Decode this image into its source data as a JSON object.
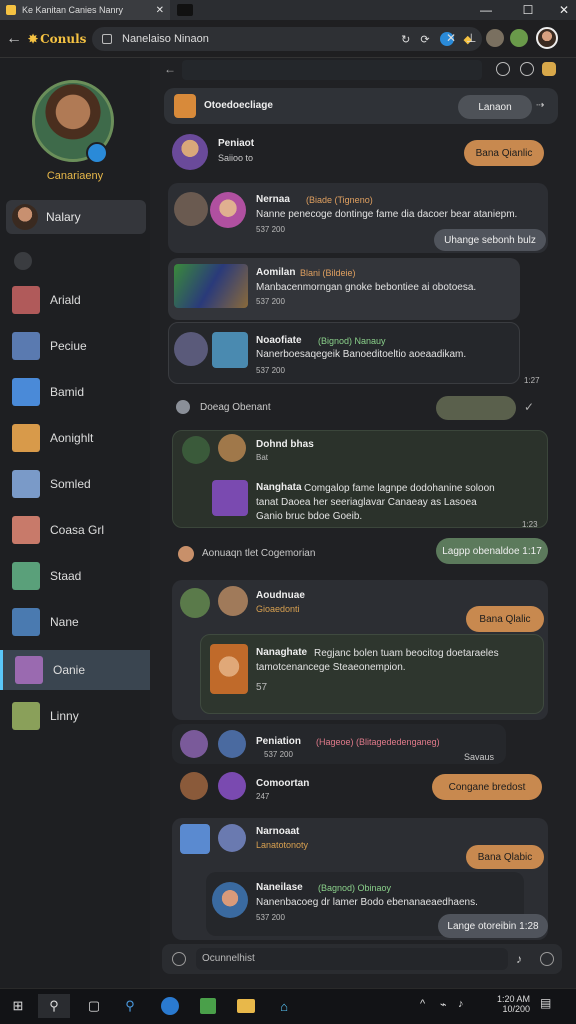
{
  "browser": {
    "tab_title": "Ke Kanitan Canies Nanry",
    "address": "Nanelaiso Ninaon"
  },
  "app": {
    "logo": "Conuls",
    "username": "Canariaeny"
  },
  "sidebar": {
    "active_top": "Nalary",
    "items": [
      {
        "label": "Ariald",
        "color": "#b05a5a"
      },
      {
        "label": "Peciue",
        "color": "#5a7ab0"
      },
      {
        "label": "Bamid",
        "color": "#4a8ad8"
      },
      {
        "label": "Aonighlt",
        "color": "#d89a4a"
      },
      {
        "label": "Somled",
        "color": "#7a9ac8"
      },
      {
        "label": "Coasa Grl",
        "color": "#c87a6a"
      },
      {
        "label": "Staad",
        "color": "#5aa07a"
      },
      {
        "label": "Nane",
        "color": "#4a7ab0"
      },
      {
        "label": "Oanie",
        "color": "#9a6ab0"
      },
      {
        "label": "Linny",
        "color": "#8aa05a"
      }
    ]
  },
  "header": {
    "title": "Otoedoecliage",
    "button": "Lanaon"
  },
  "feed": {
    "p1": {
      "name": "Peniaot",
      "sub": "Saiioo to",
      "button": "Bana Qianlic"
    },
    "p2": {
      "name": "Nernaa",
      "tag": "(Biade (Tigneno)",
      "text": "Nanne penecoge dontinge fame dia dacoer bear ataniepm.",
      "meta": "537 200",
      "button": "Uhange sebonh bulz"
    },
    "p3": {
      "name": "Aomilan",
      "tag": "Blani (Bildeie)",
      "text": "Manbacenmorngan gnoke bebontiee ai obotoesa.",
      "meta": "537 200"
    },
    "p4": {
      "name": "Noaofiate",
      "tag": "(Bignod) Nanauy",
      "text": "Nanerboesaqegeik Banoeditoeltio aoeaadikam.",
      "meta": "537 200",
      "time": "1:27"
    },
    "status": {
      "name": "Doeag Obenant"
    },
    "p5": {
      "name": "Dohnd bhas",
      "sub": "Bat",
      "name2": "Nanghata",
      "text": "Comgalop fame lagnpe dodohanine soloon tanat Daoea her seeriaglavar Canaeay as Lasoea Ganio bruc bdoe Goeib.",
      "time": "1:23"
    },
    "sys": {
      "text": "Aonuaqn tlet Cogemorian",
      "button": "Lagpp obenaldoe 1:17"
    },
    "p6": {
      "name": "Aoudnuae",
      "sub": "Gioaedonti",
      "button": "Bana Qlalic",
      "name2": "Nanaghate",
      "text": "Regjanc bolen tuam beocitog doetaraeles tamotcenancege Steaeonempion.",
      "meta": "57"
    },
    "p7": {
      "name": "Peniation",
      "tag": "(Hageoe) (Blitagededenganeg)",
      "sub": "537 200",
      "side": "Savaus"
    },
    "p8": {
      "name": "Comoortan",
      "sub": "247",
      "button": "Congane bredost"
    },
    "p9": {
      "name": "Narnoaat",
      "sub": "Lanatotonoty",
      "button": "Bana Qlabic",
      "name2": "Naneilase",
      "tag": "(Bagnod) Obinaoy",
      "text": "Nanenbacoeg dr lamer Bodo ebenanaeaedhaens.",
      "meta": "537 200",
      "bubble": "Lange otoreibin 1:28"
    }
  },
  "compose": {
    "placeholder": "Ocunnelhist"
  },
  "taskbar": {
    "time": "1:20 AM",
    "date": "10/200"
  },
  "colors": {
    "accent": "#c8894f",
    "green": "#5c7a5c",
    "active": "#5ac8fa"
  }
}
